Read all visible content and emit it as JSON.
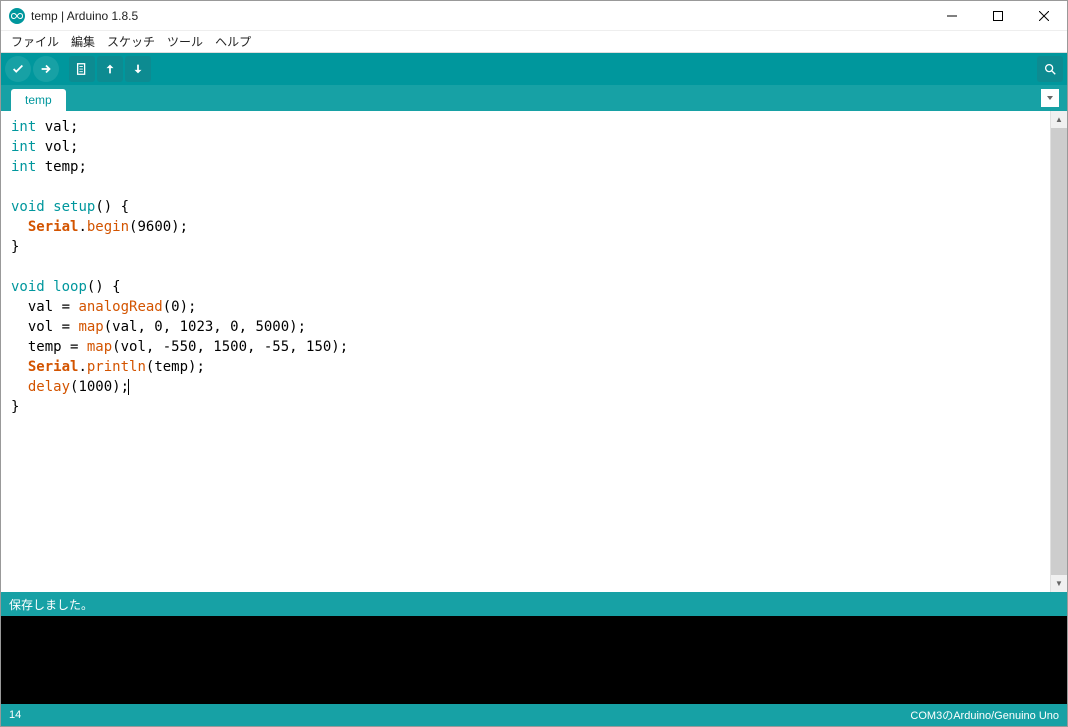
{
  "window": {
    "title": "temp | Arduino 1.8.5"
  },
  "menu": {
    "file": "ファイル",
    "edit": "編集",
    "sketch": "スケッチ",
    "tools": "ツール",
    "help": "ヘルプ"
  },
  "tab": {
    "name": "temp"
  },
  "code": {
    "lines": [
      [
        {
          "t": "int",
          "c": "type"
        },
        {
          "t": " val;",
          "c": ""
        }
      ],
      [
        {
          "t": "int",
          "c": "type"
        },
        {
          "t": " vol;",
          "c": ""
        }
      ],
      [
        {
          "t": "int",
          "c": "type"
        },
        {
          "t": " temp;",
          "c": ""
        }
      ],
      [],
      [
        {
          "t": "void",
          "c": "type"
        },
        {
          "t": " ",
          "c": ""
        },
        {
          "t": "setup",
          "c": "kw"
        },
        {
          "t": "() {",
          "c": ""
        }
      ],
      [
        {
          "t": "  ",
          "c": ""
        },
        {
          "t": "Serial",
          "c": "cls"
        },
        {
          "t": ".",
          "c": ""
        },
        {
          "t": "begin",
          "c": "fn"
        },
        {
          "t": "(9600);",
          "c": ""
        }
      ],
      [
        {
          "t": "}",
          "c": ""
        }
      ],
      [],
      [
        {
          "t": "void",
          "c": "type"
        },
        {
          "t": " ",
          "c": ""
        },
        {
          "t": "loop",
          "c": "kw"
        },
        {
          "t": "() {",
          "c": ""
        }
      ],
      [
        {
          "t": "  val = ",
          "c": ""
        },
        {
          "t": "analogRead",
          "c": "fn"
        },
        {
          "t": "(0);",
          "c": ""
        }
      ],
      [
        {
          "t": "  vol = ",
          "c": ""
        },
        {
          "t": "map",
          "c": "fn"
        },
        {
          "t": "(val, 0, 1023, 0, 5000);",
          "c": ""
        }
      ],
      [
        {
          "t": "  temp = ",
          "c": ""
        },
        {
          "t": "map",
          "c": "fn"
        },
        {
          "t": "(vol, -550, 1500, -55, 150);",
          "c": ""
        }
      ],
      [
        {
          "t": "  ",
          "c": ""
        },
        {
          "t": "Serial",
          "c": "cls"
        },
        {
          "t": ".",
          "c": ""
        },
        {
          "t": "println",
          "c": "fn"
        },
        {
          "t": "(temp);",
          "c": ""
        }
      ],
      [
        {
          "t": "  ",
          "c": ""
        },
        {
          "t": "delay",
          "c": "fn"
        },
        {
          "t": "(1000);",
          "c": ""
        },
        {
          "t": "",
          "c": "cursor-here"
        }
      ],
      [
        {
          "t": "}",
          "c": ""
        }
      ]
    ]
  },
  "status": {
    "save_msg": "保存しました。",
    "line_num": "14",
    "board": "COM3のArduino/Genuino Uno"
  }
}
